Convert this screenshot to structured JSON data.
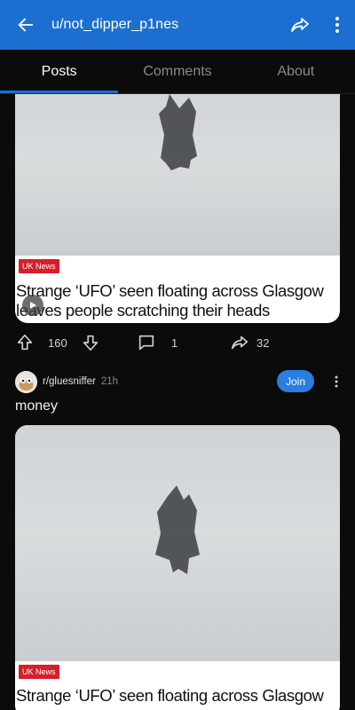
{
  "appbar": {
    "title": "u/not_dipper_p1nes",
    "back_icon": "arrow-left-icon",
    "share_icon": "share-icon",
    "more_icon": "more-vertical-icon",
    "color": "#1c6fd0"
  },
  "tabs": [
    {
      "label": "Posts",
      "active": true
    },
    {
      "label": "Comments",
      "active": false
    },
    {
      "label": "About",
      "active": false
    }
  ],
  "post1": {
    "badge": "UK News",
    "headline": "Strange ‘UFO’ seen floating across Glasgow leaves people scratching their heads",
    "upvotes": "160",
    "comments": "1",
    "shares": "32"
  },
  "post2": {
    "subreddit": "r/gluesniffer",
    "time": "21h",
    "join_label": "Join",
    "title": "money",
    "badge": "UK News",
    "headline": "Strange ‘UFO’ seen floating across Glasgow"
  }
}
